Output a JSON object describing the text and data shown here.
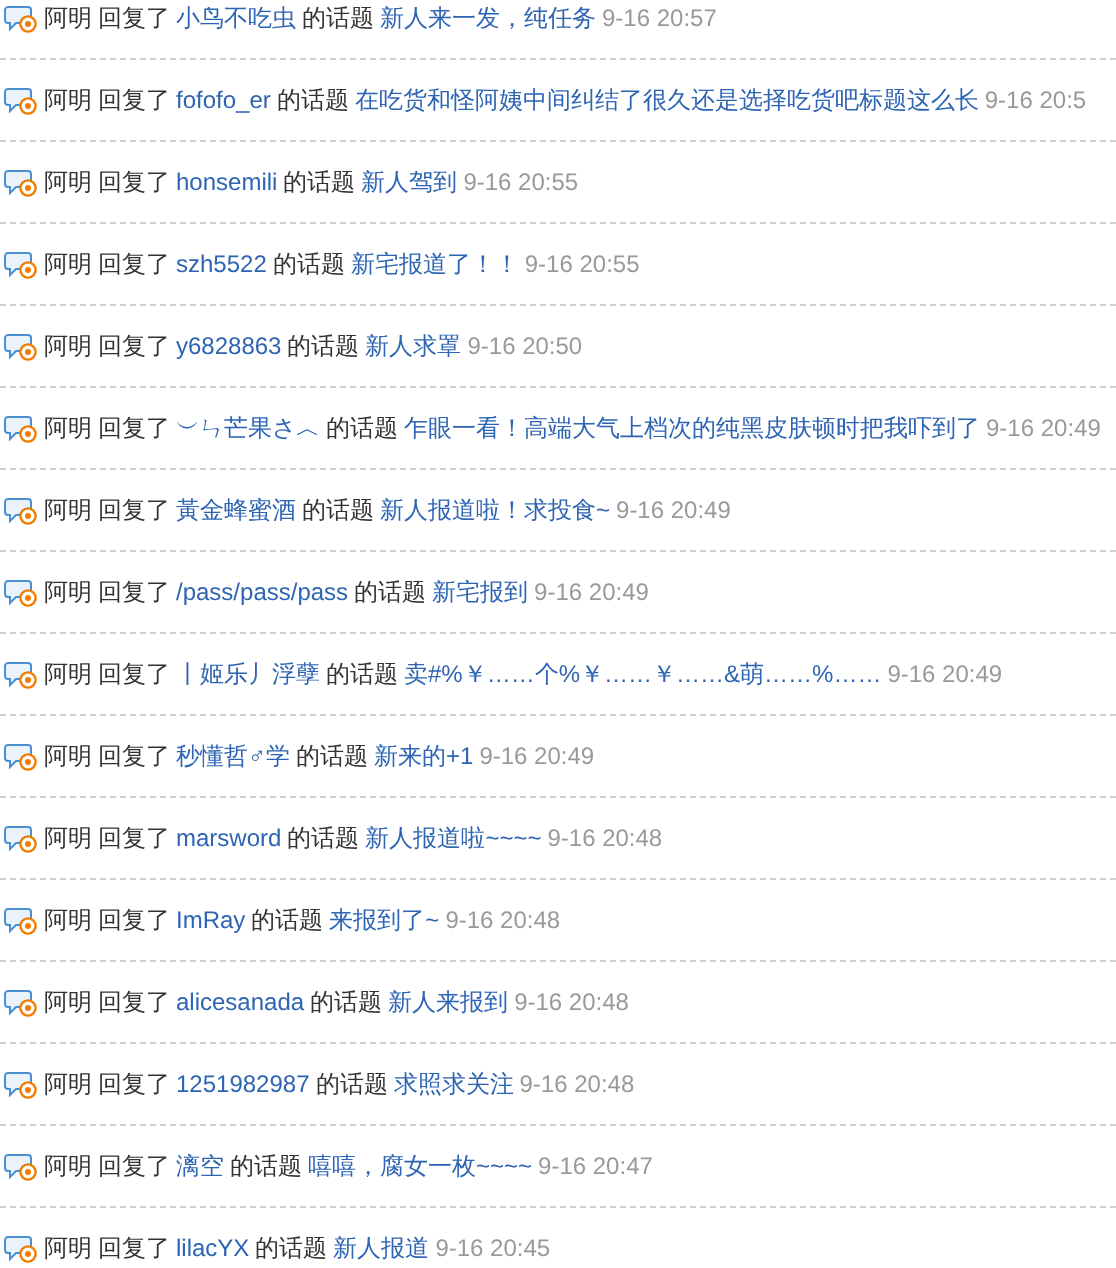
{
  "feed": [
    {
      "actor": "阿明",
      "verb": "回复了",
      "user": "小鸟不吃虫",
      "connector": "的话题",
      "topic": "新人来一发，纯任务",
      "time": "9-16 20:57"
    },
    {
      "actor": "阿明",
      "verb": "回复了",
      "user": "fofofo_er",
      "connector": "的话题",
      "topic": "在吃货和怪阿姨中间纠结了很久还是选择吃货吧标题这么长",
      "time": "9-16 20:5"
    },
    {
      "actor": "阿明",
      "verb": "回复了",
      "user": "honsemili",
      "connector": "的话题",
      "topic": "新人驾到",
      "time": "9-16 20:55"
    },
    {
      "actor": "阿明",
      "verb": "回复了",
      "user": "szh5522",
      "connector": "的话题",
      "topic": "新宅报道了！！",
      "time": "9-16 20:55"
    },
    {
      "actor": "阿明",
      "verb": "回复了",
      "user": "y6828863",
      "connector": "的话题",
      "topic": "新人求罩",
      "time": "9-16 20:50"
    },
    {
      "actor": "阿明",
      "verb": "回复了",
      "user": "︶ㄣ芒果さ︿",
      "connector": "的话题",
      "topic": "乍眼一看！高端大气上档次的纯黑皮肤顿时把我吓到了",
      "time": "9-16 20:49"
    },
    {
      "actor": "阿明",
      "verb": "回复了",
      "user": "黃金蜂蜜酒",
      "connector": "的话题",
      "topic": "新人报道啦！求投食~",
      "time": "9-16 20:49"
    },
    {
      "actor": "阿明",
      "verb": "回复了",
      "user": "/pass/pass/pass",
      "connector": "的话题",
      "topic": "新宅报到",
      "time": "9-16 20:49"
    },
    {
      "actor": "阿明",
      "verb": "回复了",
      "user": "丨姬乐丿浮孽",
      "connector": "的话题",
      "topic": "卖#%￥……个%￥……￥……&萌……%……",
      "time": "9-16 20:49"
    },
    {
      "actor": "阿明",
      "verb": "回复了",
      "user": "秒懂哲♂学",
      "connector": "的话题",
      "topic": "新来的+1",
      "time": "9-16 20:49"
    },
    {
      "actor": "阿明",
      "verb": "回复了",
      "user": "marsword",
      "connector": "的话题",
      "topic": "新人报道啦~~~~",
      "time": "9-16 20:48"
    },
    {
      "actor": "阿明",
      "verb": "回复了",
      "user": "ImRay",
      "connector": "的话题",
      "topic": "来报到了~",
      "time": "9-16 20:48"
    },
    {
      "actor": "阿明",
      "verb": "回复了",
      "user": "alicesanada",
      "connector": "的话题",
      "topic": "新人来报到",
      "time": "9-16 20:48"
    },
    {
      "actor": "阿明",
      "verb": "回复了",
      "user": "1251982987",
      "connector": "的话题",
      "topic": "求照求关注",
      "time": "9-16 20:48"
    },
    {
      "actor": "阿明",
      "verb": "回复了",
      "user": "漓空",
      "connector": "的话题",
      "topic": "嘻嘻，腐女一枚~~~~",
      "time": "9-16 20:47"
    },
    {
      "actor": "阿明",
      "verb": "回复了",
      "user": "lilacYX",
      "connector": "的话题",
      "topic": "新人报道",
      "time": "9-16 20:45"
    }
  ]
}
